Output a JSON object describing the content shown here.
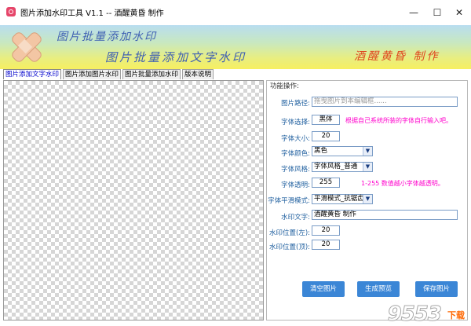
{
  "window": {
    "title": "图片添加水印工具 V1.1 -- 酒醒黄昏 制作",
    "minimize_label": "—",
    "maximize_label": "☐",
    "close_label": "✕"
  },
  "banner": {
    "line1": "图片批量添加水印",
    "line2": "图片批量添加文字水印",
    "author": "酒醒黄昏 制作"
  },
  "tabs": [
    {
      "label": "图片添加文字水印",
      "active": true
    },
    {
      "label": "图片添加图片水印",
      "active": false
    },
    {
      "label": "图片批量添加水印",
      "active": false
    },
    {
      "label": "版本说明",
      "active": false
    }
  ],
  "panel": {
    "legend": "功能操作:",
    "image_path": {
      "label": "图片路径:",
      "placeholder": "拖曳图片到本编辑框......"
    },
    "font_select": {
      "label": "字体选择:",
      "value": "黑体",
      "hint": "根据自己系统所装的字体自行输入吧。"
    },
    "font_size": {
      "label": "字体大小:",
      "value": "20"
    },
    "font_color": {
      "label": "字体颜色:",
      "value": "黑色"
    },
    "font_style": {
      "label": "字体风格:",
      "value": "字体风格_普通"
    },
    "font_opacity": {
      "label": "字体透明:",
      "value": "255",
      "hint": "1-255  数值越小字体越透明。"
    },
    "smoothing": {
      "label": "字体平滑模式:",
      "value": "平滑模式_抗锯齿"
    },
    "watermark_text": {
      "label": "水印文字:",
      "value": "酒醒黄昏 制作"
    },
    "pos_left": {
      "label": "水印位置(左):",
      "value": "20"
    },
    "pos_top": {
      "label": "水印位置(顶):",
      "value": "20"
    }
  },
  "buttons": {
    "clear": "清空图片",
    "preview": "生成预览",
    "save": "保存图片"
  },
  "site_watermark": {
    "main": "9553",
    "sub": "下载"
  },
  "colors": {
    "accent": "#3b86d6",
    "hint": "#ff00cc",
    "label": "#1f5f9f",
    "banner_text": "#3e5fb3",
    "author_text": "#e0451f"
  }
}
